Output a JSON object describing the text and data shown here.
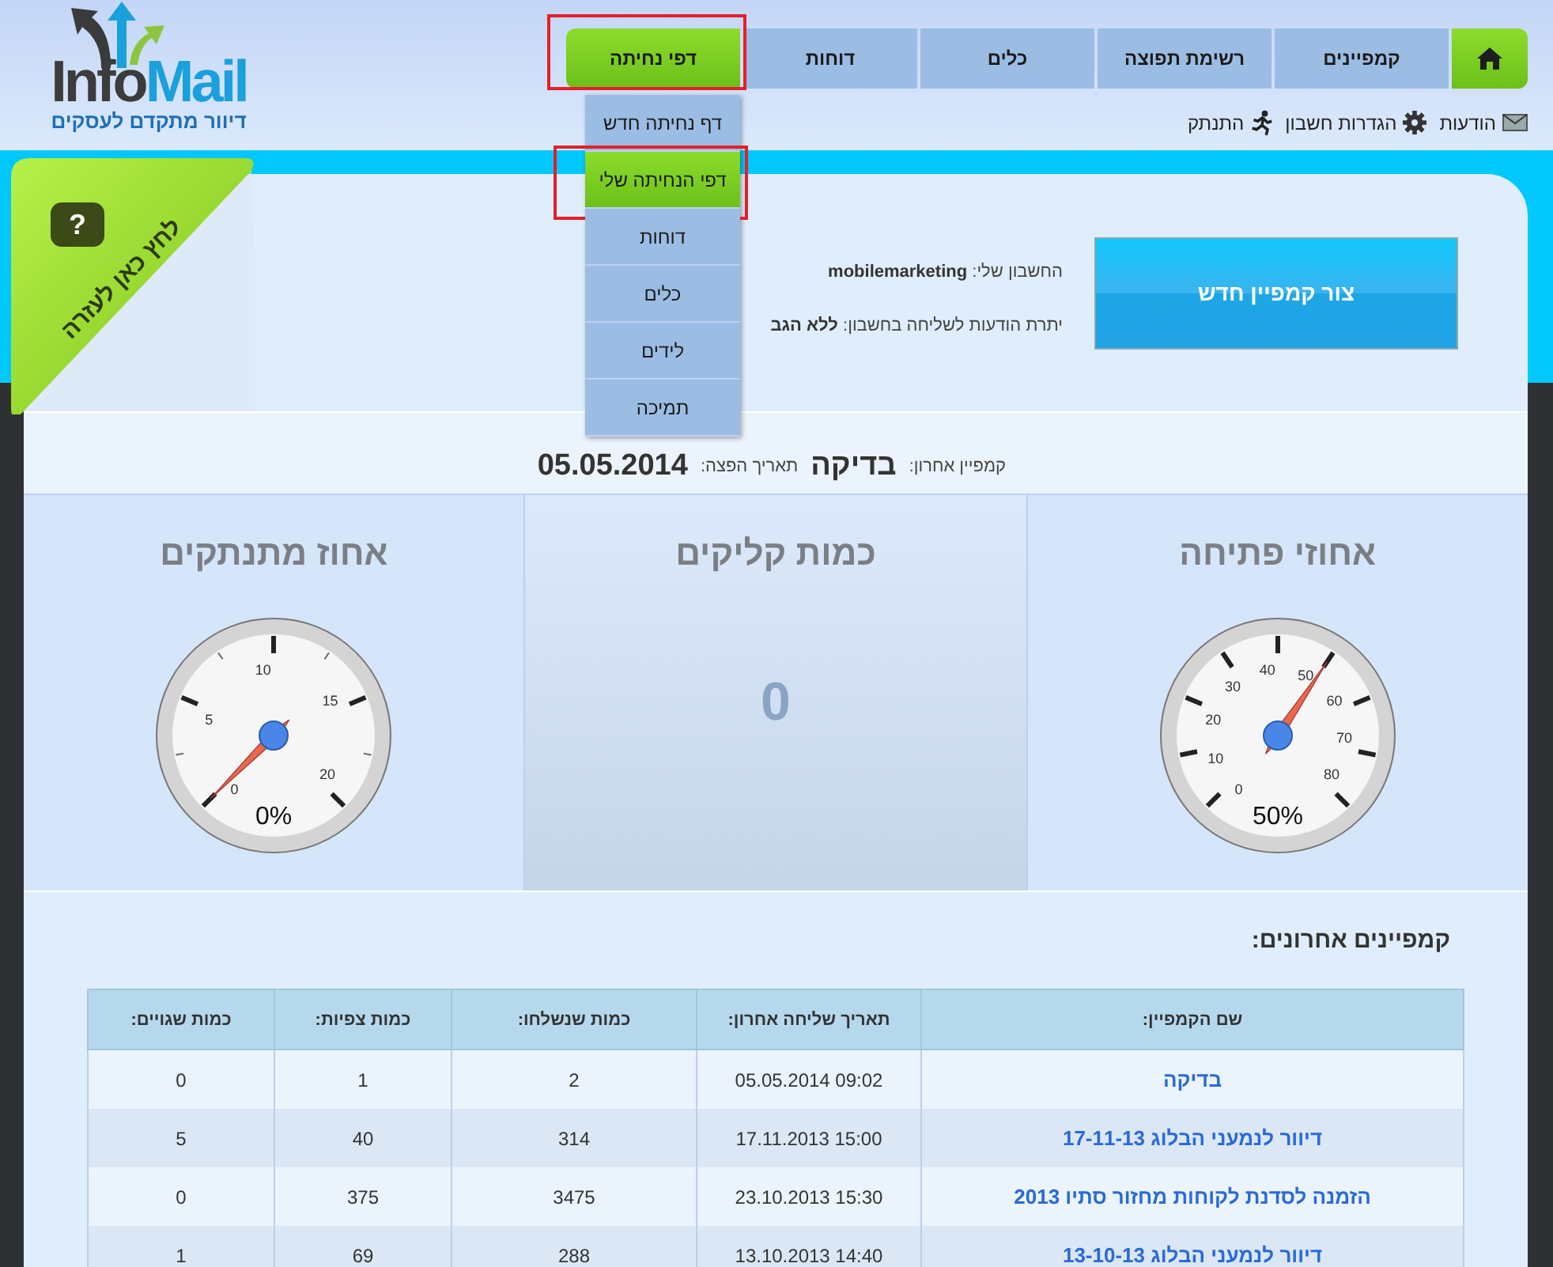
{
  "logo": {
    "brand_first": "Info",
    "brand_second": "Mail",
    "tagline": "דיוור מתקדם לעסקים"
  },
  "nav": {
    "items": [
      {
        "kind": "home",
        "selected": false,
        "highlighted": false
      },
      {
        "kind": "tab",
        "label": "קמפיינים",
        "selected": false,
        "highlighted": false
      },
      {
        "kind": "tab",
        "label": "רשימת תפוצה",
        "selected": false,
        "highlighted": false
      },
      {
        "kind": "tab",
        "label": "כלים",
        "selected": false,
        "highlighted": false
      },
      {
        "kind": "tab",
        "label": "דוחות",
        "selected": false,
        "highlighted": false
      },
      {
        "kind": "tab",
        "label": "דפי נחיתה",
        "selected": true,
        "highlighted": true
      }
    ]
  },
  "user_links": [
    {
      "kind": "messages",
      "label": "הודעות"
    },
    {
      "kind": "settings",
      "label": "הגדרות חשבון"
    },
    {
      "kind": "logout",
      "label": "התנתק"
    }
  ],
  "dropdown": {
    "items": [
      {
        "label": "דף נחיתה חדש",
        "selected": false,
        "highlighted": false
      },
      {
        "label": "דפי הנחיתה שלי",
        "selected": true,
        "highlighted": true
      },
      {
        "label": "דוחות",
        "selected": false,
        "highlighted": false
      },
      {
        "label": "כלים",
        "selected": false,
        "highlighted": false
      },
      {
        "label": "לידים",
        "selected": false,
        "highlighted": false
      },
      {
        "label": "תמיכה",
        "selected": false,
        "highlighted": false
      }
    ]
  },
  "help_ribbon": {
    "label": "לחץ כאן לעזרה",
    "icon_char": "?"
  },
  "new_campaign_button": "צור קמפיין חדש",
  "account": {
    "account_label": "החשבון שלי:",
    "account_value": "mobilemarketing",
    "balance_label": "יתרת הודעות לשליחה בחשבון:",
    "balance_value": "ללא הגב"
  },
  "last_campaign": {
    "label": "קמפיין אחרון:",
    "name": "בדיקה",
    "date_label": "תאריך הפצה:",
    "date": "05.05.2014"
  },
  "stats": [
    {
      "kind": "gauge",
      "title": "אחוזי פתיחה",
      "scale_labels": [
        "0",
        "10",
        "20",
        "30",
        "40",
        "50",
        "60",
        "70",
        "80"
      ],
      "reading": "50%"
    },
    {
      "kind": "number",
      "title": "כמות קליקים",
      "value": "0"
    },
    {
      "kind": "gauge",
      "title": "אחוז מתנתקים",
      "scale_labels": [
        "0",
        "5",
        "10",
        "15",
        "20"
      ],
      "reading": "0%"
    }
  ],
  "recent_campaigns": {
    "title": "קמפיינים אחרונים:",
    "columns": [
      "שם הקמפיין:",
      "תאריך שליחה אחרון:",
      "כמות שנשלחו:",
      "כמות צפיות:",
      "כמות שגויים:"
    ],
    "rows": [
      [
        "בדיקה",
        "05.05.2014 09:02",
        "2",
        "1",
        "0"
      ],
      [
        "דיוור לנמעני הבלוג 17-11-13",
        "17.11.2013 15:00",
        "314",
        "40",
        "5"
      ],
      [
        "הזמנה לסדנת לקוחות מחזור סתיו 2013",
        "23.10.2013 15:30",
        "3475",
        "375",
        "0"
      ],
      [
        "דיוור לנמעני הבלוג 13-10-13",
        "13.10.2013 14:40",
        "288",
        "69",
        "1"
      ]
    ]
  }
}
